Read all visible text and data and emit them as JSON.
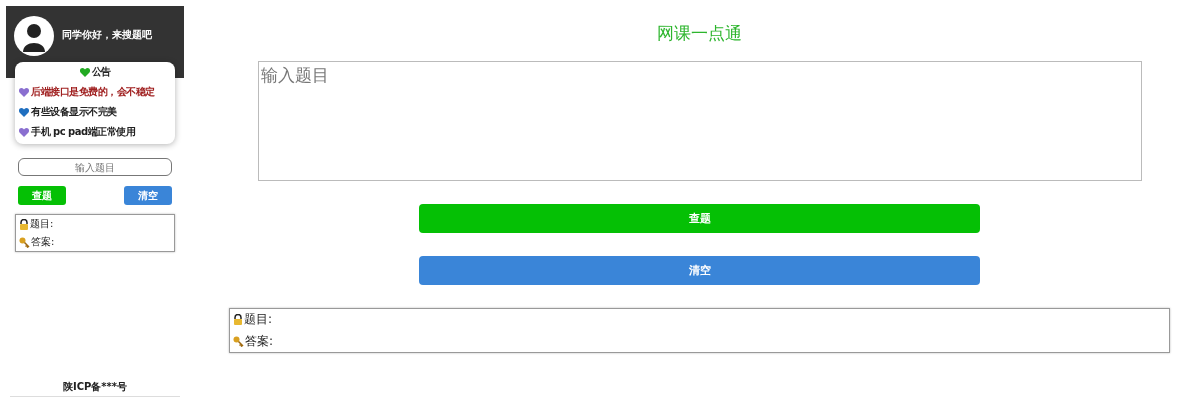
{
  "sidebar": {
    "greeting": "同学你好，来搜题吧",
    "notice": {
      "title": "公告",
      "color": "#22aa22",
      "items": [
        {
          "text": "后端接口是免费的，会不稳定",
          "color": "#8a6fd0",
          "warning": true
        },
        {
          "text": "有些设备显示不完美",
          "color": "#1f6fc0",
          "warning": false
        },
        {
          "text": "手机 pc pad端正常使用",
          "color": "#8a6fd0",
          "warning": false
        }
      ]
    },
    "search": {
      "placeholder": "输入题目"
    },
    "buttons": [
      {
        "label": "查题",
        "kind": "search"
      },
      {
        "label": "清空",
        "kind": "clear"
      }
    ],
    "result": {
      "question_label": "题目:",
      "answer_label": "答案:"
    },
    "footer": "陕ICP备***号"
  },
  "main": {
    "title": "网课一点通",
    "search": {
      "placeholder": "输入题目"
    },
    "buttons": [
      {
        "label": "查题",
        "kind": "search"
      },
      {
        "label": "清空",
        "kind": "clear"
      }
    ],
    "result": {
      "question_label": "题目:",
      "answer_label": "答案:"
    }
  }
}
